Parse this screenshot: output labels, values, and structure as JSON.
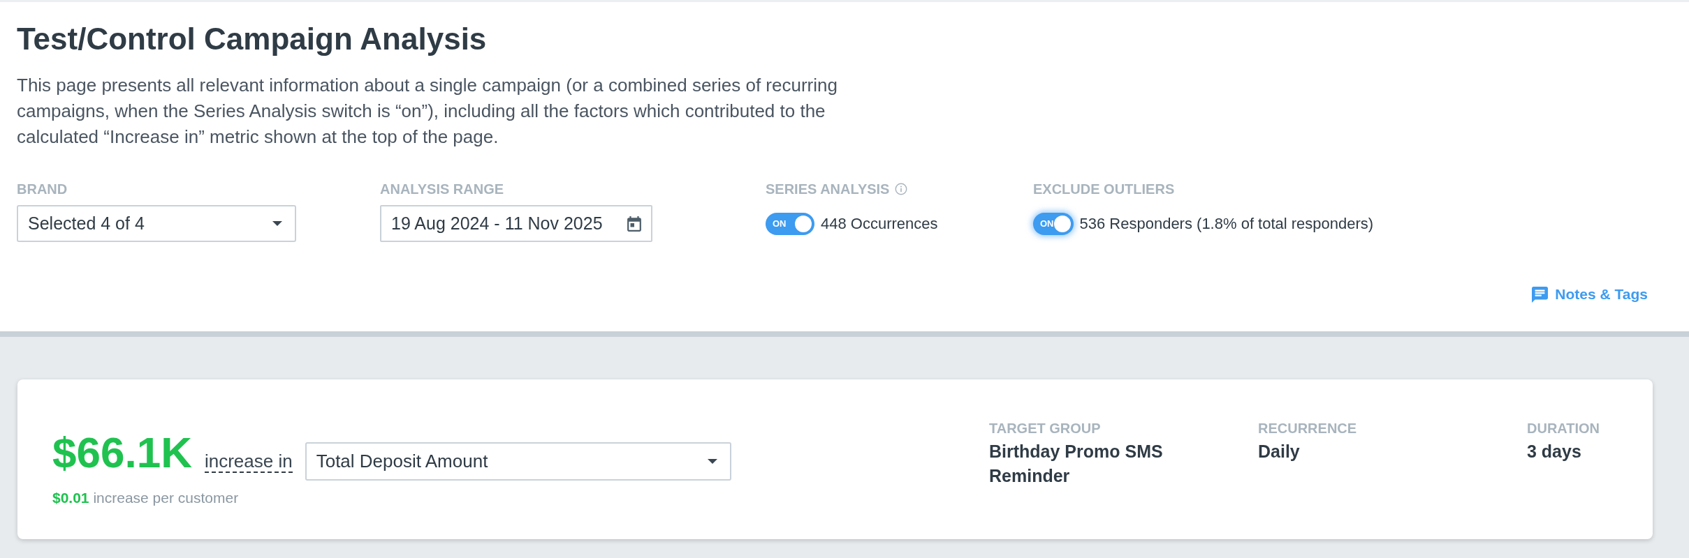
{
  "page": {
    "title": "Test/Control Campaign Analysis",
    "description": "This page presents all relevant information about a single campaign (or a combined series of recurring campaigns, when the Series Analysis switch is “on”), including all the factors which contributed to the calculated “Increase in” metric shown at the top of the page."
  },
  "filters": [
    {
      "kind": "dropdown",
      "label": "BRAND",
      "has_info": false,
      "value": "Selected 4 of 4"
    },
    {
      "kind": "date_range",
      "label": "ANALYSIS RANGE",
      "has_info": false,
      "value": "19 Aug 2024 - 11 Nov 2025"
    },
    {
      "kind": "toggle",
      "label": "SERIES ANALYSIS",
      "has_info": true,
      "focused": false,
      "on": true,
      "switch_text": "ON",
      "caption": "448 Occurrences"
    },
    {
      "kind": "toggle",
      "label": "EXCLUDE OUTLIERS",
      "has_info": false,
      "focused": true,
      "on": true,
      "switch_text": "ON",
      "caption": "536 Responders (1.8% of total responders)"
    }
  ],
  "notes_link": {
    "label": "Notes & Tags"
  },
  "summary": {
    "amount": "$66.1K",
    "connector": "increase in",
    "metric": {
      "value": "Total Deposit Amount"
    },
    "per_customer": "**$0.01** increase per customer",
    "details": [
      {
        "label": "TARGET GROUP",
        "value": "Birthday Promo SMS Reminder"
      },
      {
        "label": "RECURRENCE",
        "value": "Daily"
      },
      {
        "label": "DURATION",
        "value": "3 days"
      }
    ]
  }
}
